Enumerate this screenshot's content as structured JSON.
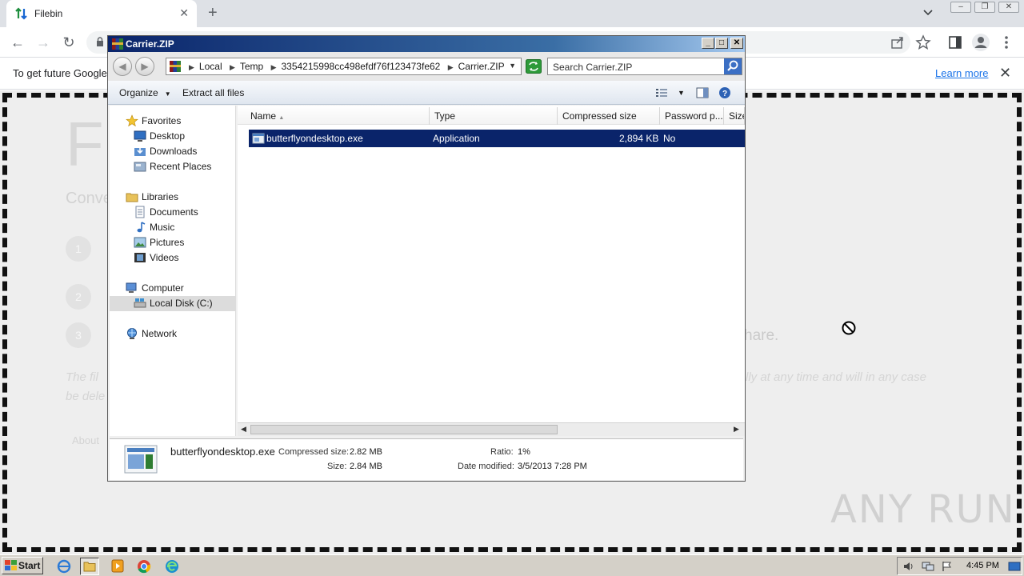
{
  "browser": {
    "tab_title": "Filebin",
    "new_tab": "+",
    "tab_close": "✕",
    "infobar_text": "To get future Google",
    "learn_more": "Learn more",
    "infobar_close": "✕"
  },
  "page": {
    "title": "Fi",
    "subtitle": "Conve",
    "steps": [
      "1",
      "2",
      "3"
    ],
    "share_text": "hare.",
    "notice_left": "The fil",
    "notice_right": "lly at any time and will in any case",
    "notice_line2": "be dele",
    "about": "About",
    "watermark": "ANY RUN"
  },
  "winrar": {
    "title": "Carrier.ZIP",
    "breadcrumb": [
      "Local",
      "Temp",
      "3354215998cc498efdf76f123473fe62",
      "Carrier.ZIP"
    ],
    "search_placeholder": "Search Carrier.ZIP",
    "commands": {
      "organize": "Organize",
      "extract_all": "Extract all files"
    },
    "nav": {
      "favorites": "Favorites",
      "desktop": "Desktop",
      "downloads": "Downloads",
      "recent_places": "Recent Places",
      "libraries": "Libraries",
      "documents": "Documents",
      "music": "Music",
      "pictures": "Pictures",
      "videos": "Videos",
      "computer": "Computer",
      "local_disk": "Local Disk (C:)",
      "network": "Network"
    },
    "columns": [
      "Name",
      "Type",
      "Compressed size",
      "Password p...",
      "Size"
    ],
    "files": [
      {
        "name": "butterflyondesktop.exe",
        "type": "Application",
        "compressed_size": "2,894 KB",
        "password": "No"
      }
    ],
    "details": {
      "name": "butterflyondesktop.exe",
      "compressed_size_label": "Compressed size:",
      "compressed_size": "2.82 MB",
      "size_label": "Size:",
      "size": "2.84 MB",
      "ratio_label": "Ratio:",
      "ratio": "1%",
      "date_label": "Date modified:",
      "date": "3/5/2013 7:28 PM"
    }
  },
  "taskbar": {
    "start": "Start",
    "clock": "4:45 PM"
  },
  "colors": {
    "selection": "#0a246a",
    "titlebar": "#0a246a",
    "link": "#1a73e8"
  }
}
